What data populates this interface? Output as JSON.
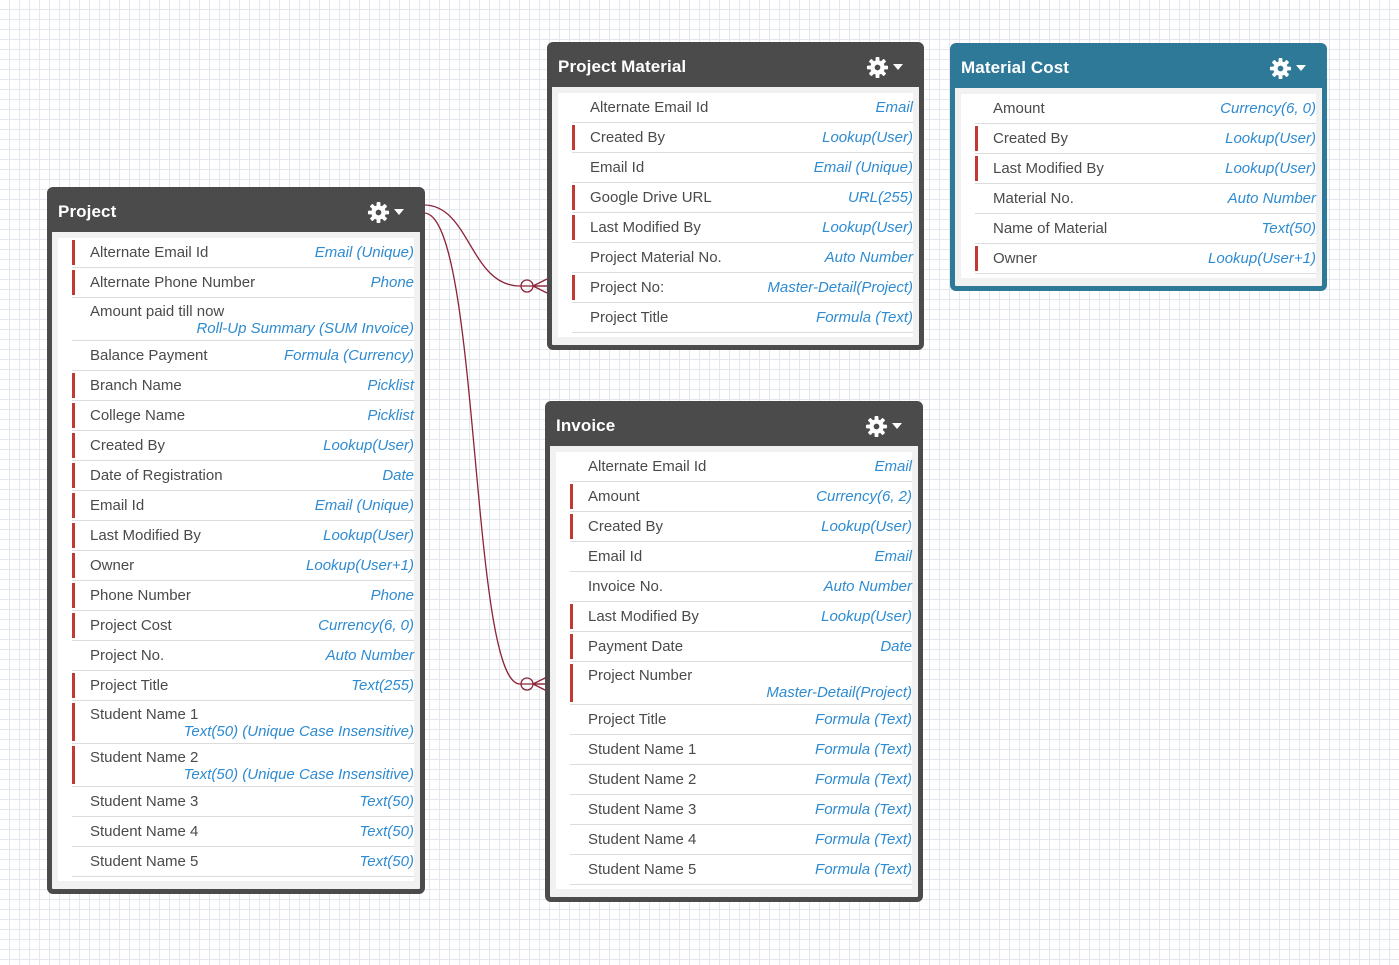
{
  "objects": {
    "project": {
      "title": "Project",
      "fields": [
        {
          "name": "Alternate Email Id",
          "type": "Email (Unique)",
          "required": true
        },
        {
          "name": "Alternate Phone Number",
          "type": "Phone",
          "required": true
        },
        {
          "name": "Amount paid till now",
          "type": "Roll-Up Summary (SUM Invoice)",
          "required": false,
          "wrap": true
        },
        {
          "name": "Balance Payment",
          "type": "Formula (Currency)",
          "required": false
        },
        {
          "name": "Branch Name",
          "type": "Picklist",
          "required": true
        },
        {
          "name": "College Name",
          "type": "Picklist",
          "required": true
        },
        {
          "name": "Created By",
          "type": "Lookup(User)",
          "required": true
        },
        {
          "name": "Date of Registration",
          "type": "Date",
          "required": true
        },
        {
          "name": "Email Id",
          "type": "Email (Unique)",
          "required": true
        },
        {
          "name": "Last Modified By",
          "type": "Lookup(User)",
          "required": true
        },
        {
          "name": "Owner",
          "type": "Lookup(User+1)",
          "required": true
        },
        {
          "name": "Phone Number",
          "type": "Phone",
          "required": true
        },
        {
          "name": "Project Cost",
          "type": "Currency(6, 0)",
          "required": true
        },
        {
          "name": "Project No.",
          "type": "Auto Number",
          "required": false
        },
        {
          "name": "Project Title",
          "type": "Text(255)",
          "required": true
        },
        {
          "name": "Student Name 1",
          "type": "Text(50) (Unique Case Insensitive)",
          "required": true,
          "wrap": true
        },
        {
          "name": "Student Name 2",
          "type": "Text(50) (Unique Case Insensitive)",
          "required": true,
          "wrap": true
        },
        {
          "name": "Student Name 3",
          "type": "Text(50)",
          "required": false
        },
        {
          "name": "Student Name 4",
          "type": "Text(50)",
          "required": false
        },
        {
          "name": "Student Name 5",
          "type": "Text(50)",
          "required": false
        }
      ]
    },
    "project_material": {
      "title": "Project Material",
      "fields": [
        {
          "name": "Alternate Email Id",
          "type": "Email",
          "required": false
        },
        {
          "name": "Created By",
          "type": "Lookup(User)",
          "required": true
        },
        {
          "name": "Email Id",
          "type": "Email (Unique)",
          "required": false
        },
        {
          "name": "Google Drive URL",
          "type": "URL(255)",
          "required": true
        },
        {
          "name": "Last Modified By",
          "type": "Lookup(User)",
          "required": true
        },
        {
          "name": "Project Material No.",
          "type": "Auto Number",
          "required": false
        },
        {
          "name": "Project No:",
          "type": "Master-Detail(Project)",
          "required": true
        },
        {
          "name": "Project Title",
          "type": "Formula (Text)",
          "required": false
        }
      ]
    },
    "material_cost": {
      "title": "Material Cost",
      "fields": [
        {
          "name": "Amount",
          "type": "Currency(6, 0)",
          "required": false
        },
        {
          "name": "Created By",
          "type": "Lookup(User)",
          "required": true
        },
        {
          "name": "Last Modified By",
          "type": "Lookup(User)",
          "required": true
        },
        {
          "name": "Material No.",
          "type": "Auto Number",
          "required": false
        },
        {
          "name": "Name of Material",
          "type": "Text(50)",
          "required": false
        },
        {
          "name": "Owner",
          "type": "Lookup(User+1)",
          "required": true
        }
      ]
    },
    "invoice": {
      "title": "Invoice",
      "fields": [
        {
          "name": "Alternate Email Id",
          "type": "Email",
          "required": false
        },
        {
          "name": "Amount",
          "type": "Currency(6, 2)",
          "required": true
        },
        {
          "name": "Created By",
          "type": "Lookup(User)",
          "required": true
        },
        {
          "name": "Email Id",
          "type": "Email",
          "required": false
        },
        {
          "name": "Invoice No.",
          "type": "Auto Number",
          "required": false
        },
        {
          "name": "Last Modified By",
          "type": "Lookup(User)",
          "required": true
        },
        {
          "name": "Payment Date",
          "type": "Date",
          "required": true
        },
        {
          "name": "Project Number",
          "type": "Master-Detail(Project)",
          "required": true,
          "wrap": true
        },
        {
          "name": "Project Title",
          "type": "Formula (Text)",
          "required": false
        },
        {
          "name": "Student Name 1",
          "type": "Formula (Text)",
          "required": false
        },
        {
          "name": "Student Name 2",
          "type": "Formula (Text)",
          "required": false
        },
        {
          "name": "Student Name 3",
          "type": "Formula (Text)",
          "required": false
        },
        {
          "name": "Student Name 4",
          "type": "Formula (Text)",
          "required": false
        },
        {
          "name": "Student Name 5",
          "type": "Formula (Text)",
          "required": false
        }
      ]
    }
  },
  "colors": {
    "header_dark": "#4b4b4b",
    "header_blue": "#2e7898",
    "required_bar": "#c23934",
    "type_text": "#2f8bd1",
    "connector": "#8c2438"
  },
  "icons": {
    "settings": "gear-icon",
    "menu": "caret-down-icon"
  }
}
